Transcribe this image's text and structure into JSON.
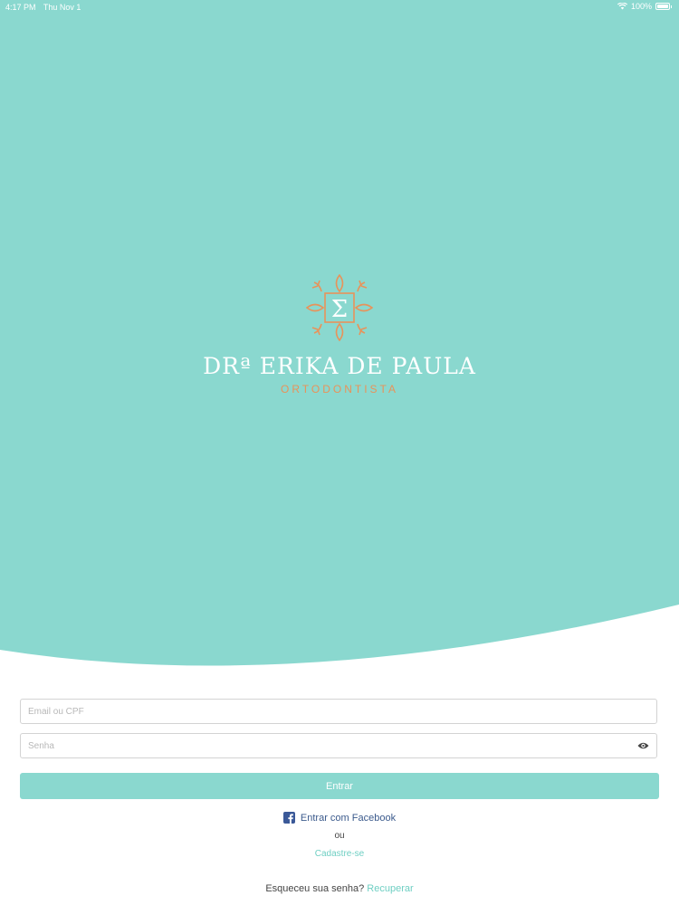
{
  "status_bar": {
    "time": "4:17 PM",
    "date": "Thu Nov 1",
    "battery": "100%"
  },
  "brand": {
    "monogram": "Σ",
    "name": "DRª ERIKA DE PAULA",
    "subtitle": "ORTODONTISTA",
    "primary_color": "#8ad8cf",
    "accent_color": "#e8935a"
  },
  "form": {
    "email_placeholder": "Email ou CPF",
    "email_value": "",
    "password_placeholder": "Senha",
    "password_value": "",
    "submit_label": "Entrar"
  },
  "links": {
    "facebook_label": "Entrar com Facebook",
    "or_label": "ou",
    "signup_label": "Cadastre-se",
    "forgot_prefix": "Esqueceu sua senha?",
    "recover_label": "Recuperar"
  },
  "icons": {
    "wifi": "wifi-icon",
    "battery": "battery-icon",
    "eye": "eye-icon",
    "facebook": "facebook-icon"
  }
}
